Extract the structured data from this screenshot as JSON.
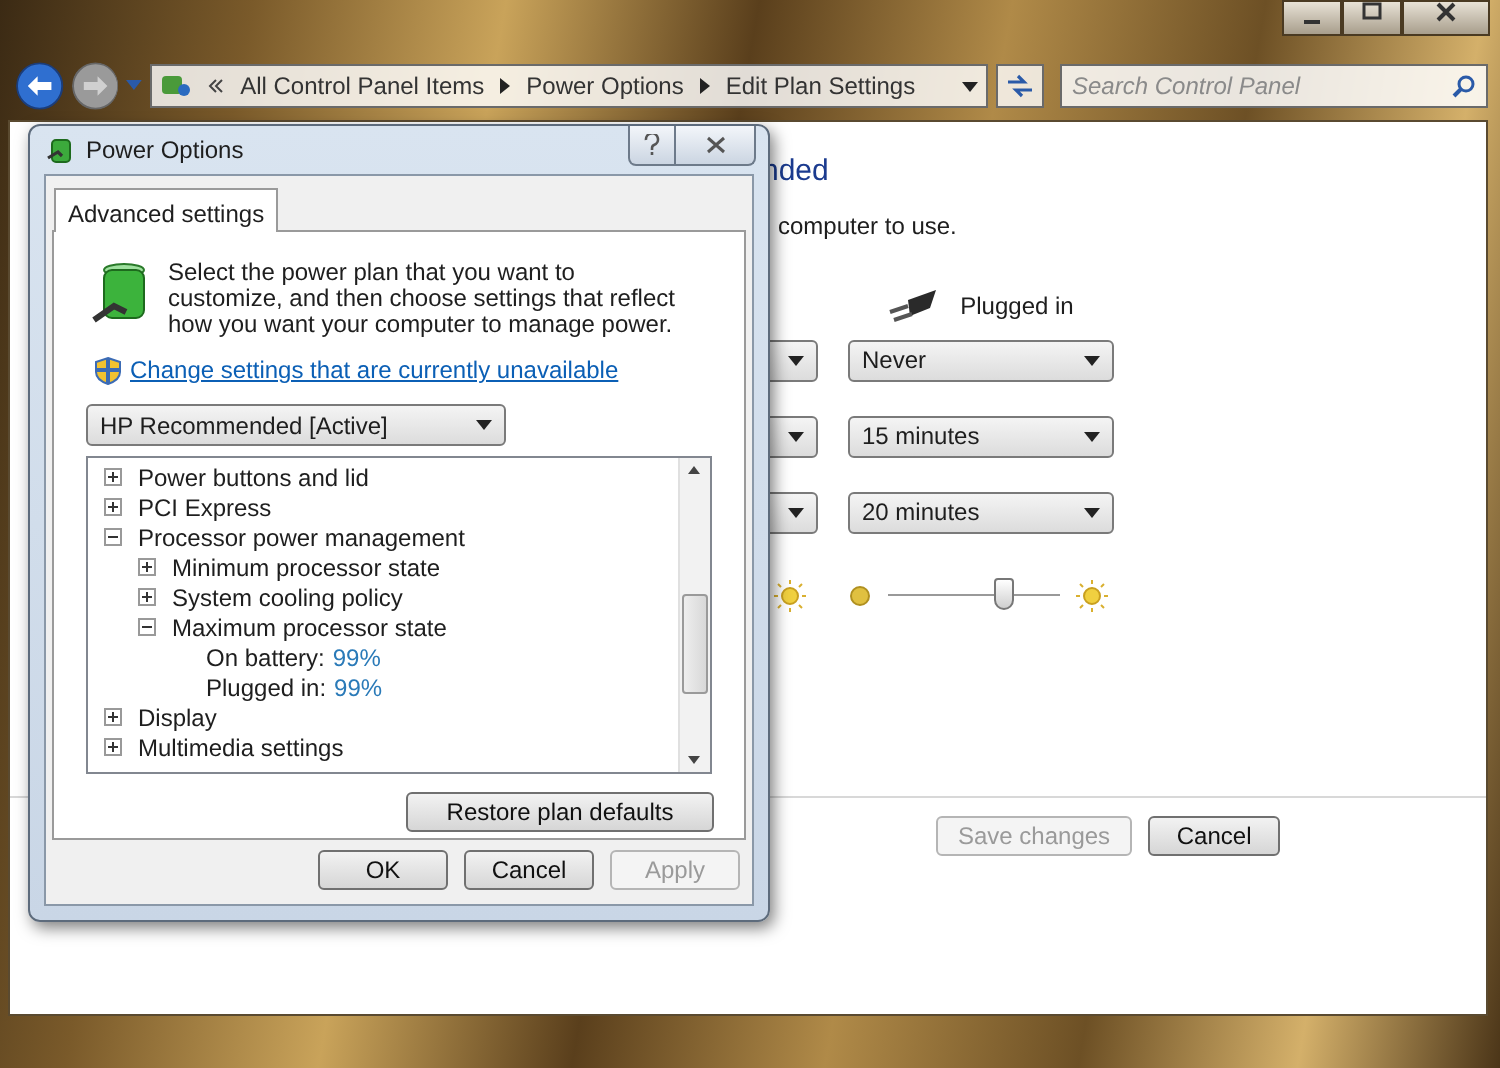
{
  "main_window": {
    "breadcrumb": [
      "All Control Panel Items",
      "Power Options",
      "Edit Plan Settings"
    ],
    "search": {
      "placeholder": "Search Control Panel"
    },
    "heading": "nded",
    "subheading": "computer to use.",
    "column_header": "Plugged in",
    "settings": [
      {
        "kind": "dropdown",
        "plugged_in": "Never"
      },
      {
        "kind": "dropdown",
        "plugged_in": "15 minutes"
      },
      {
        "kind": "dropdown",
        "plugged_in": "20 minutes"
      },
      {
        "kind": "slider",
        "level": 0.67
      }
    ],
    "buttons": [
      {
        "label": "Save changes",
        "disabled": true
      },
      {
        "label": "Cancel",
        "disabled": false
      }
    ]
  },
  "dialog": {
    "title": "Power Options",
    "tabs": [
      {
        "label": "Advanced settings",
        "selected": true
      }
    ],
    "intro": "Select the power plan that you want to customize, and then choose settings that reflect how you want your computer to manage power.",
    "admin_link": "Change settings that are currently unavailable",
    "plan": "HP Recommended [Active]",
    "tree": [
      {
        "kind": "group",
        "label": "Power buttons and lid",
        "expanded": false
      },
      {
        "kind": "group",
        "label": "PCI Express",
        "expanded": false
      },
      {
        "kind": "group",
        "label": "Processor power management",
        "expanded": true,
        "children": [
          {
            "kind": "group",
            "label": "Minimum processor state",
            "expanded": false
          },
          {
            "kind": "group",
            "label": "System cooling policy",
            "expanded": false
          },
          {
            "kind": "group",
            "label": "Maximum processor state",
            "expanded": true,
            "children": [
              {
                "kind": "value",
                "label": "On battery:",
                "value": "99%"
              },
              {
                "kind": "value",
                "label": "Plugged in:",
                "value": "99%"
              }
            ]
          }
        ]
      },
      {
        "kind": "group",
        "label": "Display",
        "expanded": false
      },
      {
        "kind": "group",
        "label": "Multimedia settings",
        "expanded": false
      }
    ],
    "restore_button": "Restore plan defaults",
    "buttons": [
      {
        "label": "OK",
        "disabled": false
      },
      {
        "label": "Cancel",
        "disabled": false
      },
      {
        "label": "Apply",
        "disabled": true
      }
    ]
  }
}
